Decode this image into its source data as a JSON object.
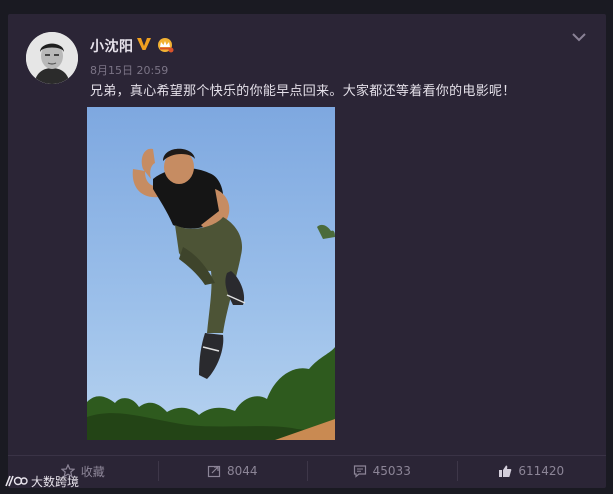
{
  "post": {
    "username": "小沈阳",
    "verified_icon": "verified-v-icon",
    "vip_icon": "vip-crown-icon",
    "timestamp": "8月15日 20:59",
    "text": "兄弟，真心希望那个快乐的你能早点回来。大家都还等着看你的电影呢！",
    "photo_description_icon": "jumping-man-photo"
  },
  "actions": {
    "favorite_label": "收藏",
    "repost_count": "8044",
    "comment_count": "45033",
    "like_count": "611420"
  },
  "watermark": {
    "text": "大数跨境"
  },
  "colors": {
    "card_bg": "#2b2536",
    "verified": "#f0a020",
    "text": "#e3dfe8",
    "muted": "#8c8597"
  }
}
